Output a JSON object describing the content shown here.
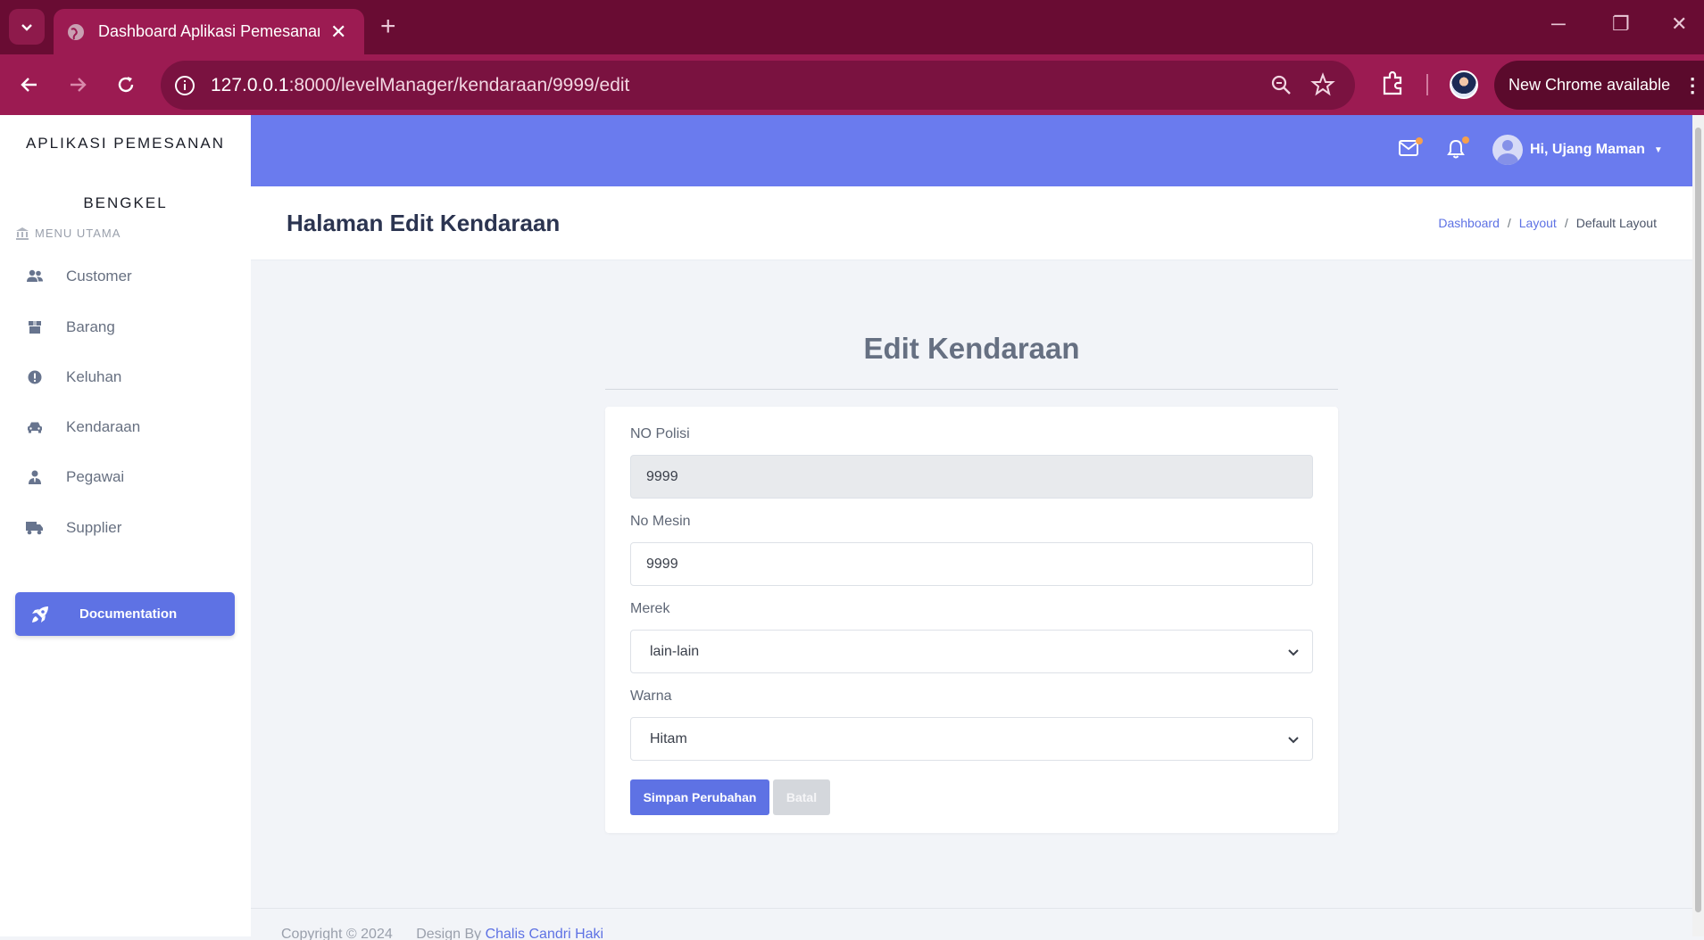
{
  "browser": {
    "tab_title": "Dashboard Aplikasi Pemesanan",
    "url_host": "127.0.0.1",
    "url_rest": ":8000/levelManager/kendaraan/9999/edit",
    "update_label": "New Chrome available"
  },
  "sidebar": {
    "brand_line1": "APLIKASI PEMESANAN",
    "brand_line2": "BENGKEL",
    "menu_heading": "MENU UTAMA",
    "items": [
      {
        "label": "Customer",
        "icon": "users-icon"
      },
      {
        "label": "Barang",
        "icon": "box-icon"
      },
      {
        "label": "Keluhan",
        "icon": "alert-circle-icon"
      },
      {
        "label": "Kendaraan",
        "icon": "car-icon"
      },
      {
        "label": "Pegawai",
        "icon": "user-tie-icon"
      },
      {
        "label": "Supplier",
        "icon": "truck-icon"
      }
    ],
    "doc_button": "Documentation"
  },
  "topbar": {
    "user_greeting": "Hi, Ujang Maman"
  },
  "header": {
    "title": "Halaman Edit Kendaraan",
    "breadcrumb": [
      "Dashboard",
      "Layout",
      "Default Layout"
    ]
  },
  "form": {
    "title": "Edit Kendaraan",
    "fields": [
      {
        "label": "NO Polisi",
        "value": "9999"
      },
      {
        "label": "No Mesin",
        "value": "9999"
      },
      {
        "label": "Merek",
        "value": "lain-lain"
      },
      {
        "label": "Warna",
        "value": "Hitam"
      }
    ],
    "save_label": "Simpan Perubahan",
    "cancel_label": "Batal"
  },
  "footer": {
    "copyright": "Copyright © 2024",
    "design_prefix": "Design By",
    "design_author": "Chalis Candri Haki"
  },
  "colors": {
    "browser_frame": "#690c33",
    "accent": "#5e72e4",
    "topbar": "#6a7bee"
  }
}
